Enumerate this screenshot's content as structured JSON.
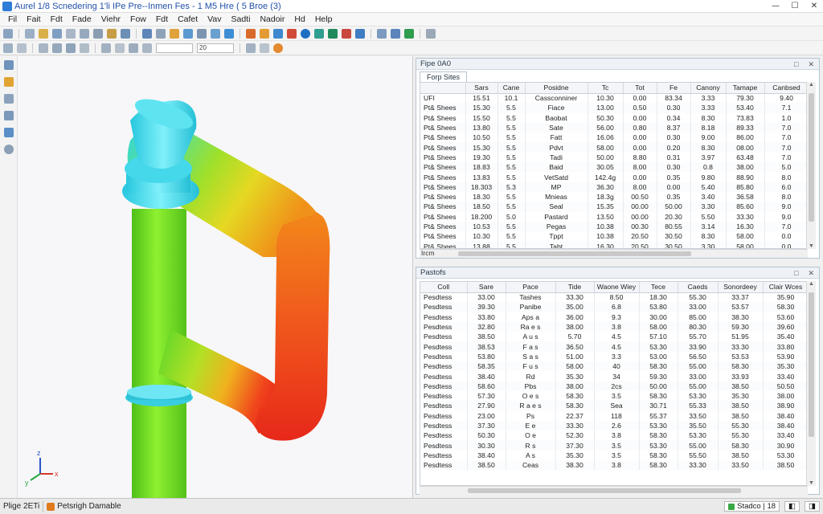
{
  "window": {
    "title": "Aurel 1/8 Scnedering 1'li IPe Pre--Inmen Fes - 1 M5 Hre ( 5 Broe (3)",
    "controls": [
      "—",
      "☐",
      "✕"
    ]
  },
  "menu": [
    "Fil",
    "Fait",
    "Fdt",
    "Fade",
    "Viehr",
    "Fow",
    "Fdt",
    "Cafet",
    "Vav",
    "Sadti",
    "Nadoir",
    "Hd",
    "Help"
  ],
  "toolbar": {
    "select1": "",
    "select2": "20"
  },
  "colors": {
    "pipe_cyan": "#2fd4e6",
    "pipe_green": "#6fdc1e",
    "pipe_yellow": "#e0dc22",
    "pipe_orange": "#f08a18",
    "pipe_red": "#ea2a18"
  },
  "viewport": {
    "axis_labels": [
      "z",
      "x",
      "y"
    ]
  },
  "panel_top": {
    "title": "Fipe 0A0",
    "tab": "Forp Sites",
    "header_buttons": [
      "□",
      "✕"
    ],
    "columns": [
      "",
      "Sars",
      "Cane",
      "Posidne",
      "Tc",
      "Tot",
      "Fe",
      "Canony",
      "Tamape",
      "Canbsed"
    ],
    "rows": [
      [
        "UFI",
        "15.51",
        "10.1",
        "Cassconniner",
        "10.30",
        "0.00",
        "83.34",
        "3.33",
        "79.30",
        "9.40"
      ],
      [
        "Pt& Shees",
        "15.30",
        "5.5",
        "Fiace",
        "13.00",
        "0.50",
        "0.30",
        "3.33",
        "53.40",
        "7.1"
      ],
      [
        "Pt& Shees",
        "15.50",
        "5.5",
        "Baobat",
        "50.30",
        "0.00",
        "0.34",
        "8.30",
        "73.83",
        "1.0"
      ],
      [
        "Pt& Shees",
        "13.80",
        "5.5",
        "Sate",
        "56.00",
        "0.80",
        "8.37",
        "8.18",
        "89.33",
        "7.0"
      ],
      [
        "Pt& Shees",
        "10.50",
        "5.5",
        "Fatt",
        "16.06",
        "0.00",
        "0.30",
        "9.00",
        "86.00",
        "7.0"
      ],
      [
        "Pt& Shees",
        "15.30",
        "5.5",
        "Pdvt",
        "58.00",
        "0.00",
        "0.20",
        "8.30",
        "08.00",
        "7.0"
      ],
      [
        "Pt& Shees",
        "19.30",
        "5.5",
        "Tadi",
        "50.00",
        "8.80",
        "0.31",
        "3.97",
        "63.48",
        "7.0"
      ],
      [
        "Pt& Shees",
        "18.83",
        "5.5",
        "Baid",
        "30.05",
        "8.00",
        "0.30",
        "0.8",
        "38.00",
        "5.0"
      ],
      [
        "Pt& Shees",
        "13.83",
        "5.5",
        "VetSatd",
        "142.4g",
        "0.00",
        "0.35",
        "9.80",
        "88.90",
        "8.0"
      ],
      [
        "Pt& Shees",
        "18.303",
        "5.3",
        "MP",
        "36.30",
        "8.00",
        "0.00",
        "5.40",
        "85.80",
        "6.0"
      ],
      [
        "Pt& Shees",
        "18.30",
        "5.5",
        "Mnieas",
        "18.3g",
        "00.50",
        "0.35",
        "3.40",
        "36.58",
        "8.0"
      ],
      [
        "Pt& Shees",
        "18.50",
        "5.5",
        "Seal",
        "15.35",
        "00.00",
        "50.00",
        "3.30",
        "85.60",
        "9.0"
      ],
      [
        "Pt& Shees",
        "18.200",
        "5.0",
        "Pastard",
        "13.50",
        "00.00",
        "20.30",
        "5.50",
        "33.30",
        "9.0"
      ],
      [
        "Pt& Shees",
        "10.53",
        "5.5",
        "Pegas",
        "10.38",
        "00.30",
        "80.55",
        "3.14",
        "16.30",
        "7.0"
      ],
      [
        "Pt& Shees",
        "10.30",
        "5.5",
        "Tppt",
        "10.38",
        "20.50",
        "30.50",
        "8.30",
        "58.00",
        "0.0"
      ],
      [
        "Pt& Shees",
        "13.88",
        "5.5",
        "Tabt",
        "16.30",
        "20.50",
        "30.50",
        "3.30",
        "58.00",
        "0.0"
      ]
    ],
    "footer_label": "  Ircm"
  },
  "panel_bottom": {
    "title": "Pastofs",
    "header_buttons": [
      "□",
      "✕"
    ],
    "columns": [
      "Coll",
      "Sare",
      "Pace",
      "Tide",
      "Waone Wiey",
      "Tece",
      "Caeds",
      "Sonordeey",
      "Clair Wces"
    ],
    "rows": [
      [
        "Pesdtess",
        "33.00",
        "Tashes",
        "33.30",
        "8.50",
        "18.30",
        "55.30",
        "33.37",
        "35.90"
      ],
      [
        "Pesdtess",
        "39.30",
        "Panibe",
        "35.00",
        "6.8",
        "53.80",
        "33.00",
        "53.57",
        "58.30"
      ],
      [
        "Pesdtess",
        "33.80",
        "Aps a",
        "36.00",
        "9.3",
        "30.00",
        "85.00",
        "38.30",
        "53.60"
      ],
      [
        "Pesdtess",
        "32.80",
        "Ra e s",
        "38.00",
        "3.8",
        "58.00",
        "80.30",
        "59.30",
        "39.60"
      ],
      [
        "Pesdtess",
        "38.50",
        "A u s",
        "5.70",
        "4.5",
        "57.10",
        "55.70",
        "51.95",
        "35.40"
      ],
      [
        "Pesdtess",
        "38.53",
        "F a s",
        "36.50",
        "4.5",
        "53.30",
        "33.90",
        "33.30",
        "33.80"
      ],
      [
        "Pesdtess",
        "53.80",
        "S a s",
        "51.00",
        "3.3",
        "53.00",
        "56.50",
        "53.53",
        "53.90"
      ],
      [
        "Pesdtess",
        "58.35",
        "F u s",
        "58.00",
        "40",
        "58.30",
        "55.00",
        "58.30",
        "35.30"
      ],
      [
        "Pesdtess",
        "38.40",
        "Rd",
        "35.30",
        "34",
        "59.30",
        "33.00",
        "33.93",
        "33.40"
      ],
      [
        "Pesdtess",
        "58.60",
        "Pbs",
        "38.00",
        "2cs",
        "50.00",
        "55.00",
        "38.50",
        "50.50"
      ],
      [
        "Pesdtess",
        "57.30",
        "O e s",
        "58.30",
        "3.5",
        "58.30",
        "53.30",
        "35.30",
        "38.00"
      ],
      [
        "Pesdtess",
        "27.90",
        "R a e s",
        "58.30",
        "Sea",
        "30.71",
        "55.33",
        "38.50",
        "38.90"
      ],
      [
        "Pesdtess",
        "23.00",
        "Ps",
        "22.37",
        "118",
        "55.37",
        "33.50",
        "38.50",
        "38.40"
      ],
      [
        "Pesdtess",
        "37.30",
        "E e",
        "33.30",
        "2.6",
        "53.30",
        "35.50",
        "55.30",
        "38.40"
      ],
      [
        "Pesdtess",
        "50.30",
        "O e",
        "52.30",
        "3.8",
        "58.30",
        "53.30",
        "55.30",
        "33.40"
      ],
      [
        "Pesdtess",
        "30.30",
        "R s",
        "37.30",
        "3.5",
        "53.30",
        "55.00",
        "58.30",
        "30.90"
      ],
      [
        "Pesdtess",
        "38.40",
        "A s",
        "35.30",
        "3.5",
        "58.30",
        "55.50",
        "38.50",
        "53.30"
      ],
      [
        "Pesdtess",
        "38.50",
        "Ceas",
        "38.30",
        "3.8",
        "58.30",
        "33.30",
        "33.50",
        "38.50"
      ]
    ]
  },
  "status": {
    "left_text": "Plige 2ETi",
    "left_text2": "Petsrigh Damable",
    "right_text": "Stadco | 18",
    "right_buttons": [
      "◧",
      "◨"
    ]
  }
}
